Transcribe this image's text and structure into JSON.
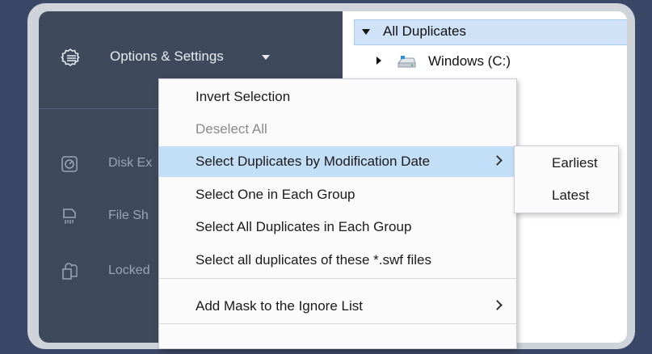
{
  "sidebar": {
    "options_label": "Options & Settings",
    "items": [
      {
        "label": "Disk Ex",
        "icon": "disk-explorer-icon"
      },
      {
        "label": "File Sh",
        "icon": "file-shredder-icon"
      },
      {
        "label": "Locked",
        "icon": "locked-files-icon"
      }
    ]
  },
  "tree": {
    "root_label": "All Duplicates",
    "drive_label": "Windows (C:)"
  },
  "menu": {
    "items": [
      {
        "label": "Invert Selection",
        "disabled": false
      },
      {
        "label": "Deselect All",
        "disabled": true
      },
      {
        "label": "Select Duplicates by Modification Date",
        "submenu": true,
        "active": true
      },
      {
        "label": "Select One in Each Group"
      },
      {
        "label": "Select All Duplicates in Each Group"
      },
      {
        "label": "Select all duplicates of these *.swf files"
      },
      {
        "label": "Add Mask to the Ignore List",
        "submenu": true
      }
    ]
  },
  "submenu": {
    "items": [
      {
        "label": "Earliest"
      },
      {
        "label": "Latest"
      }
    ]
  },
  "colors": {
    "sidebar_bg": "#3e4a5c",
    "highlight": "#c3def7",
    "page_bg": "#3b4766"
  }
}
